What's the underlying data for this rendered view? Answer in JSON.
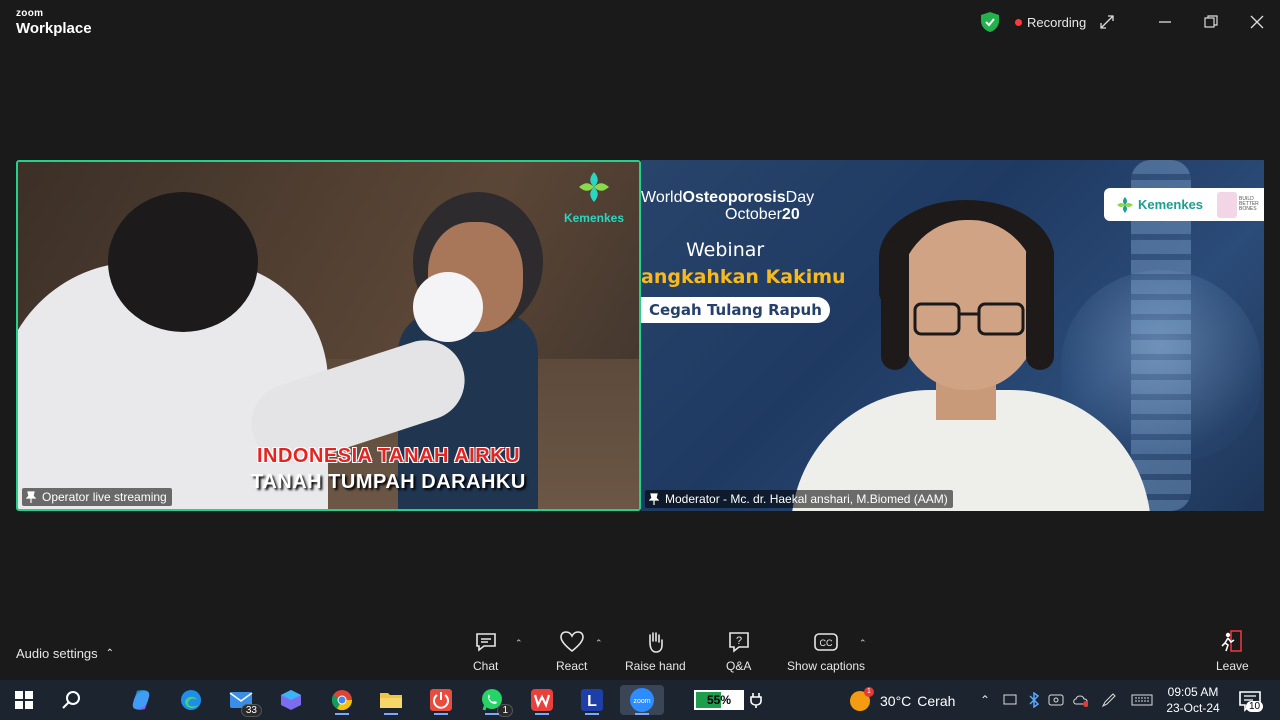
{
  "app": {
    "brand_top": "zoom",
    "brand_bottom": "Workplace"
  },
  "titlebar": {
    "recording_label": "Recording"
  },
  "tiles": {
    "left": {
      "name": "Operator live streaming",
      "logo_text": "Kemenkes",
      "caption_line1": "INDONESIA TANAH AIRKU",
      "caption_line2": "TANAH TUMPAH DARAHKU"
    },
    "right": {
      "name": "Moderator - Mc. dr. Haekal anshari, M.Biomed (AAM)",
      "event_title_a": "World",
      "event_title_b": "Osteoporosis",
      "event_title_c": "Day",
      "event_date_a": "October",
      "event_date_b": "20",
      "webinar": "Webinar",
      "slogan1": "angkahkan Kakimu",
      "slogan2": "Cegah Tulang Rapuh",
      "badge_text": "Kemenkes",
      "badge_bbb": "BUILD BETTER BONES"
    }
  },
  "toolbar": {
    "audio_settings": "Audio settings",
    "chat": "Chat",
    "react": "React",
    "raise_hand": "Raise hand",
    "qa": "Q&A",
    "captions": "Show captions",
    "leave": "Leave"
  },
  "taskbar": {
    "mail_badge": "33",
    "whatsapp_badge": "1",
    "battery_percent": "55%",
    "battery_level": 0.55,
    "weather_temp": "30°C",
    "weather_desc": "Cerah",
    "time": "09:05 AM",
    "date": "23-Oct-24",
    "notifications": "10",
    "zoom_label": "zoom",
    "l_label": "L"
  },
  "colors": {
    "active_speaker": "#23d18b",
    "recording": "#ff3b3b",
    "taskbar": "#1c2430"
  }
}
